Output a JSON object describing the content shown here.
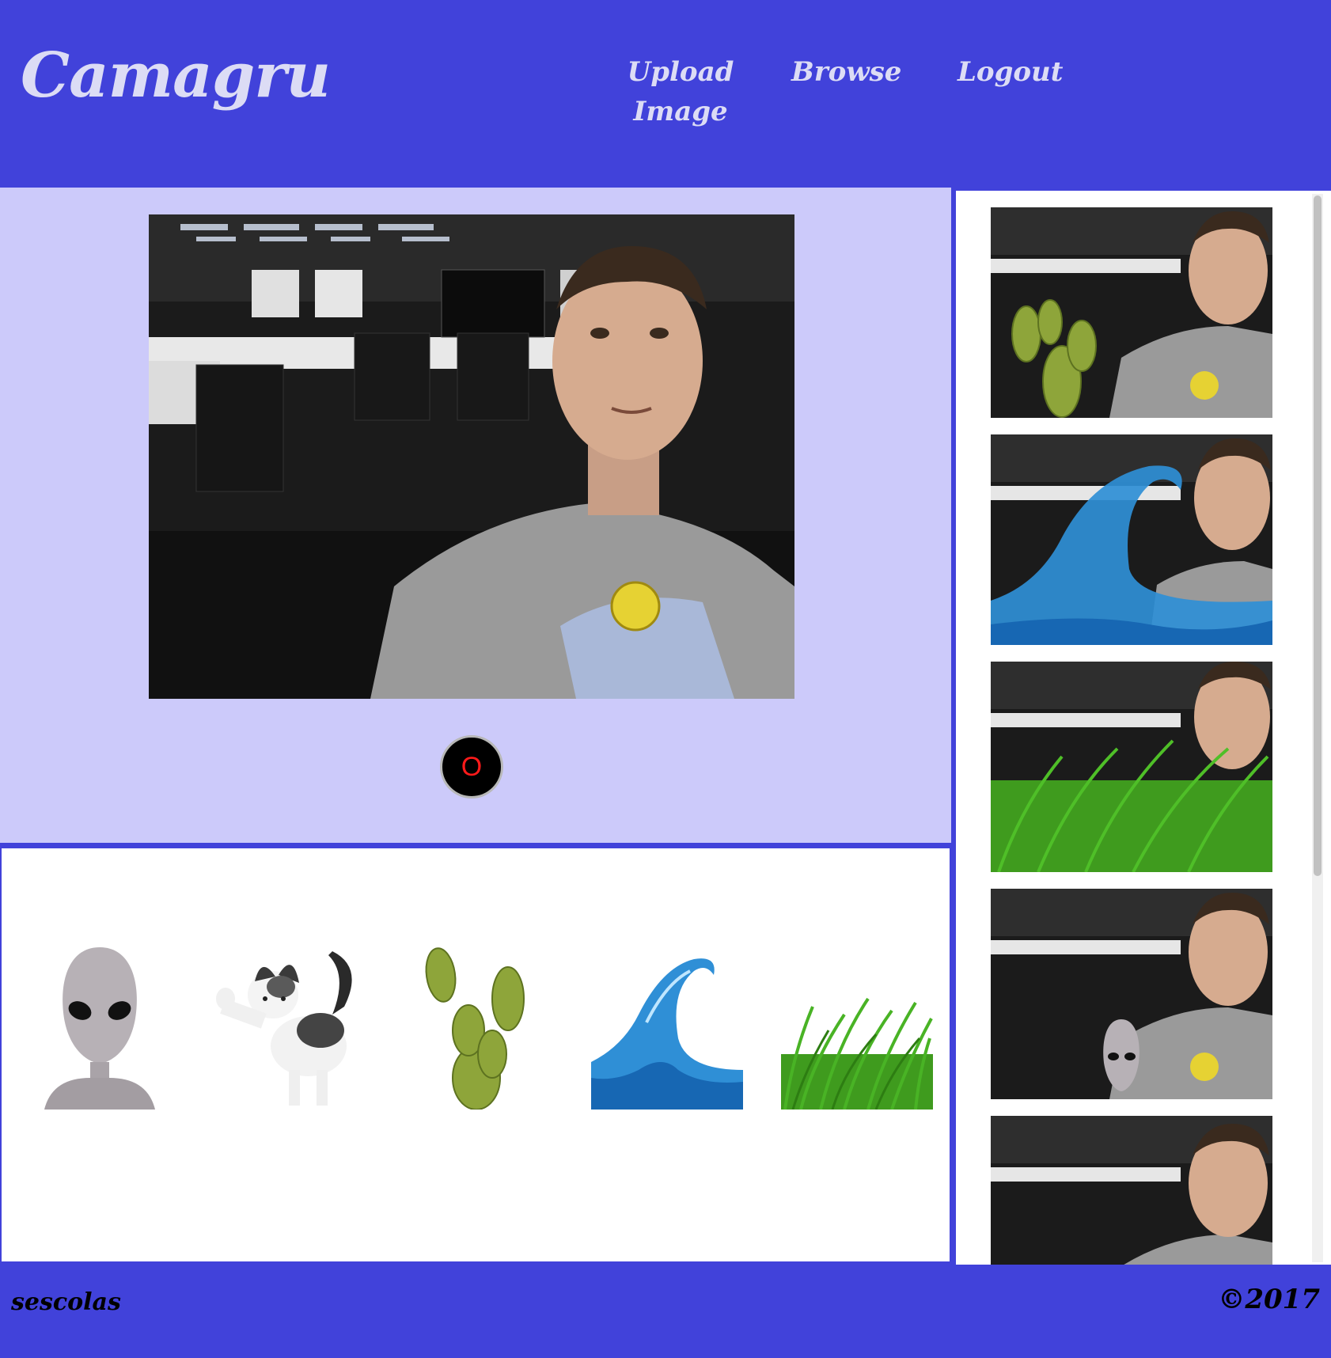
{
  "app": {
    "title": "Camagru"
  },
  "nav": {
    "upload_line1": "Upload",
    "upload_line2": "Image",
    "browse": "Browse",
    "logout": "Logout"
  },
  "camera": {
    "shutter_label": "O"
  },
  "stickers": [
    {
      "name": "alien"
    },
    {
      "name": "cat"
    },
    {
      "name": "cactus"
    },
    {
      "name": "water-splash"
    },
    {
      "name": "grass"
    }
  ],
  "gallery": [
    {
      "overlay": "cactus"
    },
    {
      "overlay": "water-splash"
    },
    {
      "overlay": "grass"
    },
    {
      "overlay": "alien"
    },
    {
      "overlay": "none"
    }
  ],
  "footer": {
    "user": "sescolas",
    "copyright": "©2017"
  },
  "colors": {
    "brand": "#4142da",
    "camera_bg": "#cccafa",
    "nav_text": "#dcdcf5",
    "shutter_mark": "#ff1a1a"
  }
}
